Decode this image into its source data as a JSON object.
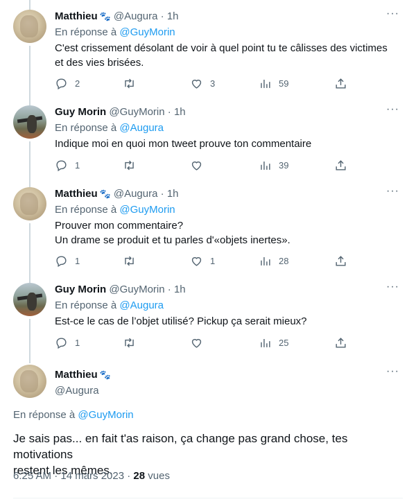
{
  "tweets": [
    {
      "name": "Matthieu",
      "paw": "🐾",
      "handle": "@Augura",
      "dot": "·",
      "time": "1h",
      "reply_prefix": "En réponse à",
      "reply_to": "@GuyMorin",
      "text": "C'est crissement désolant de voir à quel point tu te câlisses des victimes\net des vies brisées.",
      "replies": "2",
      "retweets": "",
      "likes": "3",
      "views": "59",
      "avatar": "matthieu"
    },
    {
      "name": "Guy Morin",
      "paw": "",
      "handle": "@GuyMorin",
      "dot": "·",
      "time": "1h",
      "reply_prefix": "En réponse à",
      "reply_to": "@Augura",
      "text": "Indique moi en quoi mon tweet prouve ton commentaire",
      "replies": "1",
      "retweets": "",
      "likes": "",
      "views": "39",
      "avatar": "guy"
    },
    {
      "name": "Matthieu",
      "paw": "🐾",
      "handle": "@Augura",
      "dot": "·",
      "time": "1h",
      "reply_prefix": "En réponse à",
      "reply_to": "@GuyMorin",
      "text": "Prouver mon commentaire?\nUn drame se produit et tu parles d'«objets inertes».",
      "replies": "1",
      "retweets": "",
      "likes": "1",
      "views": "28",
      "avatar": "matthieu"
    },
    {
      "name": "Guy Morin",
      "paw": "",
      "handle": "@GuyMorin",
      "dot": "·",
      "time": "1h",
      "reply_prefix": "En réponse à",
      "reply_to": "@Augura",
      "text": "Est-ce le cas de l’objet utilisé? Pickup ça serait mieux?",
      "replies": "1",
      "retweets": "",
      "likes": "",
      "views": "25",
      "avatar": "guy"
    }
  ],
  "main": {
    "name": "Matthieu",
    "paw": "🐾",
    "handle": "@Augura",
    "reply_prefix": "En réponse à",
    "reply_to": "@GuyMorin",
    "text": "Je sais pas... en fait t'as raison, ça change pas grand chose, tes motivations\nrestent les mêmes.",
    "timestamp": "6:25 AM · 14 mars 2023 ·",
    "views_count": "28",
    "views_label": "vues"
  },
  "more_icon": "···",
  "colors": {
    "link": "#1d9bf0",
    "muted": "#536471",
    "text": "#0f1419",
    "thread_line": "#cfd9de"
  }
}
